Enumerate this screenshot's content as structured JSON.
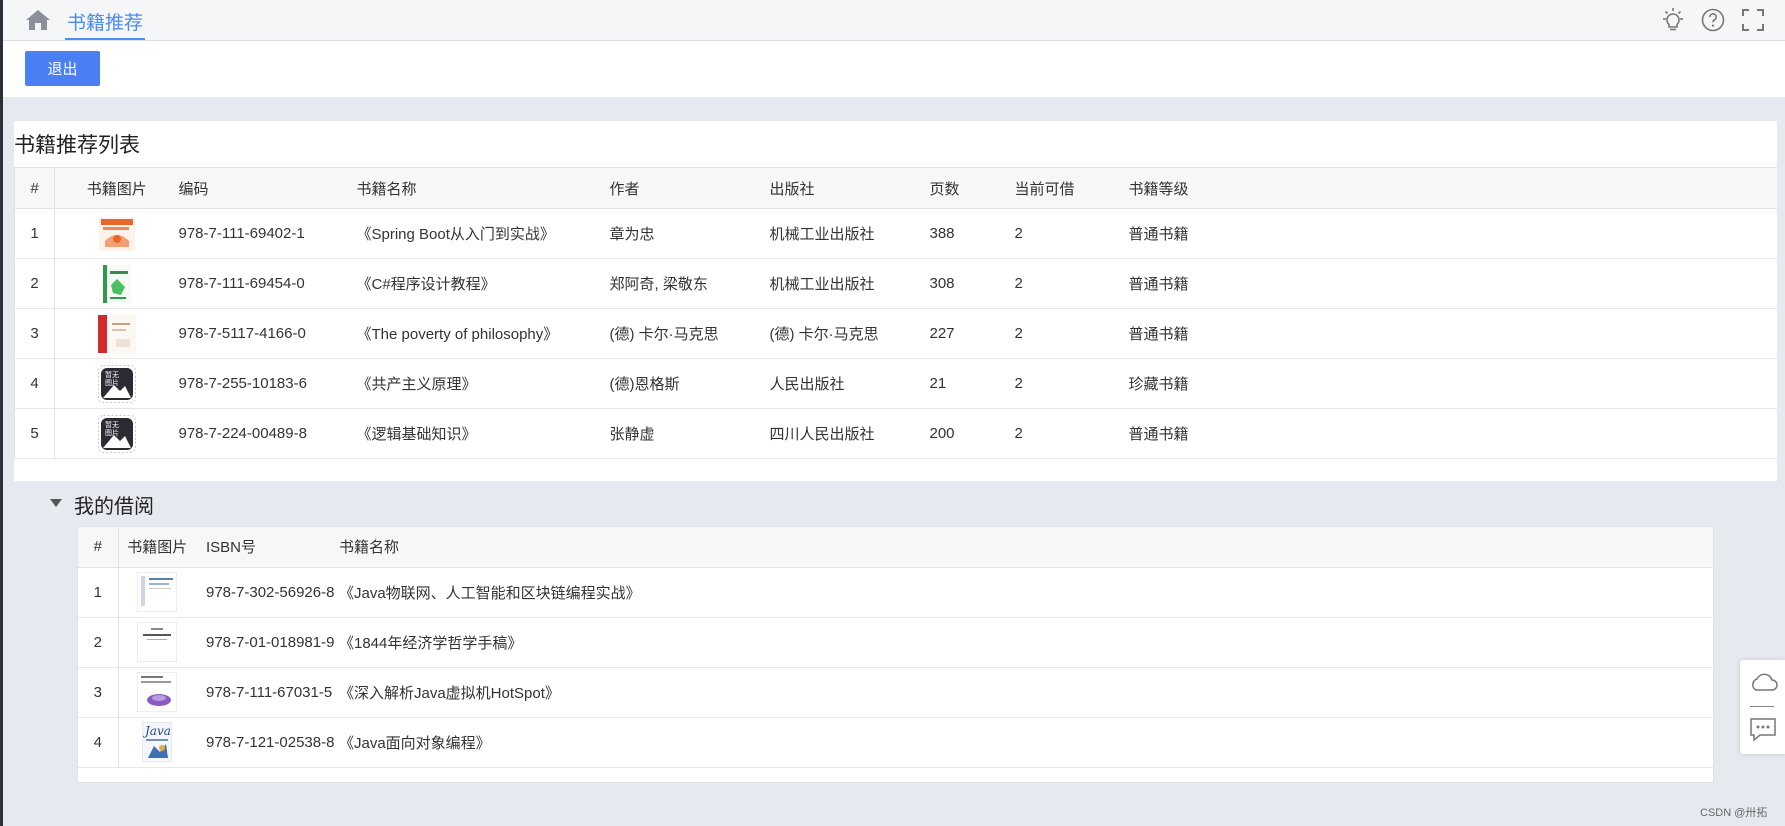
{
  "topbar": {
    "tab_label": "书籍推荐",
    "icons": [
      "home-icon",
      "lightbulb-icon",
      "help-circle-icon",
      "fullscreen-icon"
    ]
  },
  "actions": {
    "exit_label": "退出"
  },
  "recommend": {
    "title": "书籍推荐列表",
    "headers": [
      "#",
      "书籍图片",
      "编码",
      "书籍名称",
      "作者",
      "出版社",
      "页数",
      "当前可借",
      "书籍等级"
    ],
    "rows": [
      {
        "idx": "1",
        "code": "978-7-111-69402-1",
        "name": "《Spring Boot从入门到实战》",
        "author": "章为忠",
        "publisher": "机械工业出版社",
        "pages": "388",
        "available": "2",
        "level": "普通书籍"
      },
      {
        "idx": "2",
        "code": "978-7-111-69454-0",
        "name": "《C#程序设计教程》",
        "author": "郑阿奇, 梁敬东",
        "publisher": "机械工业出版社",
        "pages": "308",
        "available": "2",
        "level": "普通书籍"
      },
      {
        "idx": "3",
        "code": "978-7-5117-4166-0",
        "name": "《The poverty of philosophy》",
        "author": "(德) 卡尔·马克思",
        "publisher": "(德) 卡尔·马克思",
        "pages": "227",
        "available": "2",
        "level": "普通书籍"
      },
      {
        "idx": "4",
        "code": "978-7-255-10183-6",
        "name": "《共产主义原理》",
        "author": "(德)恩格斯",
        "publisher": "人民出版社",
        "pages": "21",
        "available": "2",
        "level": "珍藏书籍"
      },
      {
        "idx": "5",
        "code": "978-7-224-00489-8",
        "name": "《逻辑基础知识》",
        "author": "张静虚",
        "publisher": "四川人民出版社",
        "pages": "200",
        "available": "2",
        "level": "普通书籍"
      }
    ],
    "placeholder_text": "暂无\n图片"
  },
  "borrow": {
    "title": "我的借阅",
    "headers": [
      "#",
      "书籍图片",
      "ISBN号",
      "书籍名称"
    ],
    "rows": [
      {
        "idx": "1",
        "isbn": "978-7-302-56926-8",
        "name": "《Java物联网、人工智能和区块链编程实战》"
      },
      {
        "idx": "2",
        "isbn": "978-7-01-018981-9",
        "name": "《1844年经济学哲学手稿》"
      },
      {
        "idx": "3",
        "isbn": "978-7-111-67031-5",
        "name": "《深入解析Java虚拟机HotSpot》"
      },
      {
        "idx": "4",
        "isbn": "978-7-121-02538-8",
        "name": "《Java面向对象编程》"
      }
    ],
    "cover4_text": "Java"
  },
  "watermark": "CSDN @卅拓",
  "colors": {
    "accent": "#4b80f5",
    "tab_active": "#4b8bf4",
    "background": "#e6e9ef"
  }
}
